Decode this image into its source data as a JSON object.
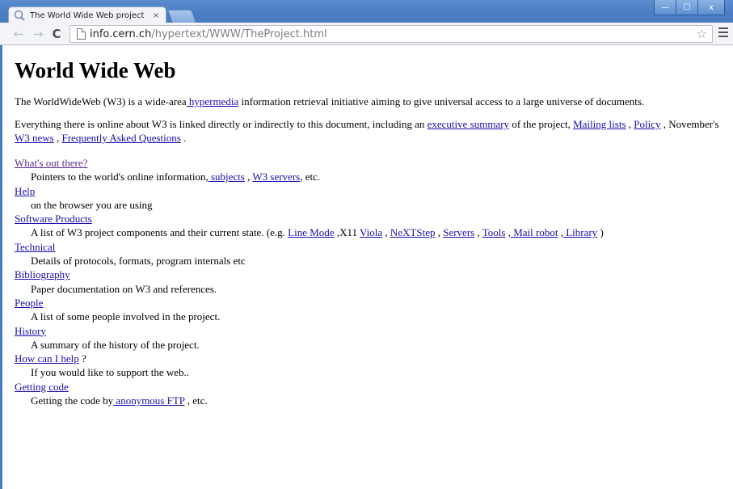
{
  "browser": {
    "tab_title": "The World Wide Web project",
    "tab_close": "×",
    "url_host": "info.cern.ch",
    "url_path": "/hypertext/WWW/TheProject.html",
    "window_controls": {
      "minimize": "—",
      "maximize": "☐",
      "close": "x"
    }
  },
  "page": {
    "title": "World Wide Web",
    "intro": {
      "text_1": "The WorldWideWeb (W3) is a wide-area",
      "link_hypermedia": " hypermedia",
      "text_2": " information retrieval initiative aiming to give universal access to a large universe of documents."
    },
    "para2": {
      "text_1": "Everything there is online about W3 is linked directly or indirectly to this document, including an ",
      "link_exec": "executive summary",
      "text_2": " of the project, ",
      "link_mailing": "Mailing lists",
      "sep_1": " , ",
      "link_policy": "Policy",
      "text_3": " , November's ",
      "link_news": "W3 news",
      "sep_2": " , ",
      "link_faq": "Frequently Asked Questions",
      "text_4": " ."
    },
    "sections": {
      "whats_out": {
        "title": "What's out there?",
        "desc_1": "Pointers to the world's online information,",
        "link_subjects": " subjects",
        "sep": " , ",
        "link_servers": "W3 servers",
        "desc_2": ", etc."
      },
      "help": {
        "title": "Help",
        "desc": "on the browser you are using"
      },
      "software": {
        "title": "Software Products",
        "desc_1": "A list of W3 project components and their current state. (e.g. ",
        "link_line_mode": "Line Mode",
        "text_x11": " ,X11 ",
        "link_viola": "Viola",
        "sep_1": " , ",
        "link_nextstep": "NeXTStep",
        "sep_2": " , ",
        "link_servers": "Servers",
        "sep_3": " , ",
        "link_tools": "Tools",
        "sep_4": " ,",
        "link_mail_robot": " Mail robot",
        "sep_5": " ,",
        "link_library": " Library",
        "desc_2": " )"
      },
      "technical": {
        "title": "Technical",
        "desc": "Details of protocols, formats, program internals etc"
      },
      "bibliography": {
        "title": "Bibliography",
        "desc": "Paper documentation on W3 and references."
      },
      "people": {
        "title": "People",
        "desc": "A list of some people involved in the project."
      },
      "history": {
        "title": "History",
        "desc": "A summary of the history of the project."
      },
      "how_help": {
        "title": "How can I help",
        "suffix": " ?",
        "desc": "If you would like to support the web.."
      },
      "getting_code": {
        "title": "Getting code",
        "desc_1": "Getting the code by",
        "link_ftp": " anonymous FTP",
        "desc_2": " , etc."
      }
    }
  },
  "colors": {
    "link": "#1a0dab",
    "visited_link": "#5b2b8f",
    "window_frame": "#4a7bc2",
    "toolbar": "#f2f4f7"
  },
  "icons": [
    "tab-favicon-icon",
    "close-icon",
    "back-arrow-icon",
    "forward-arrow-icon",
    "reload-icon",
    "page-icon",
    "star-icon",
    "menu-icon",
    "minimize-icon",
    "maximize-icon"
  ]
}
